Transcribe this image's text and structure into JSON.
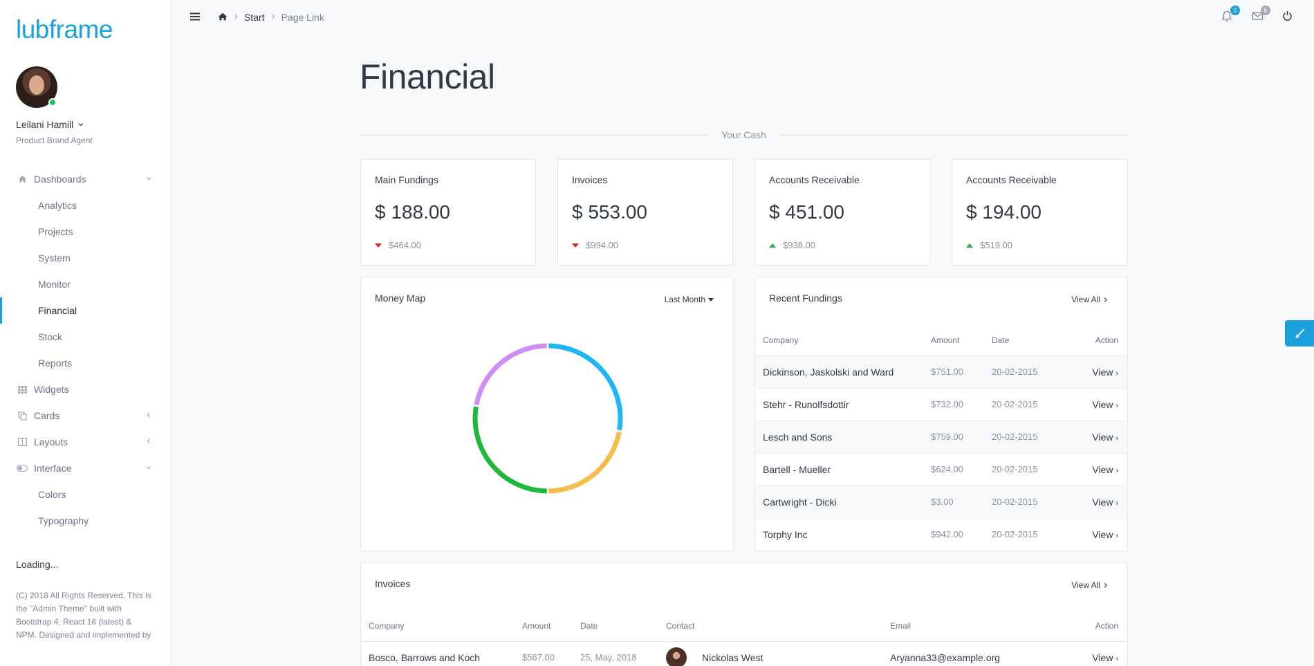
{
  "sidebar": {
    "brand": "lubframe",
    "user_name": "Leilani Hamill",
    "user_role": "Product Brand Agent",
    "menu": [
      {
        "label": "Dashboards",
        "icon": "home-icon"
      },
      {
        "label": "Analytics"
      },
      {
        "label": "Projects"
      },
      {
        "label": "System"
      },
      {
        "label": "Monitor"
      },
      {
        "label": "Financial"
      },
      {
        "label": "Stock"
      },
      {
        "label": "Reports"
      },
      {
        "label": "Widgets",
        "icon": "grid-icon"
      },
      {
        "label": "Cards",
        "icon": "copy-icon"
      },
      {
        "label": "Layouts",
        "icon": "columns-icon"
      },
      {
        "label": "Interface",
        "icon": "toggle-icon"
      },
      {
        "label": "Colors"
      },
      {
        "label": "Typography"
      }
    ],
    "loading": "Loading...",
    "copyright": "(C) 2018 All Rights Reserved. This is the \"Admin Theme\" built with Bootstrap 4, React 16 (latest) & NPM. Designed and implemented by"
  },
  "header": {
    "breadcrumb": [
      "Start",
      "Page Link"
    ],
    "notifications_count": "6",
    "messages_count": "6"
  },
  "page": {
    "title": "Financial",
    "section_label": "Your Cash"
  },
  "stats": [
    {
      "title": "Main Fundings",
      "value": "$ 188.00",
      "sub": "$464.00",
      "trend": "down"
    },
    {
      "title": "Invoices",
      "value": "$ 553.00",
      "sub": "$994.00",
      "trend": "down"
    },
    {
      "title": "Accounts Receivable",
      "value": "$ 451.00",
      "sub": "$938.00",
      "trend": "up"
    },
    {
      "title": "Accounts Receivable",
      "value": "$ 194.00",
      "sub": "$519.00",
      "trend": "up"
    }
  ],
  "money_map": {
    "title": "Money Map",
    "period": "Last Month"
  },
  "chart_data": {
    "type": "pie",
    "title": "",
    "values": [
      25,
      20,
      25,
      20
    ],
    "colors": [
      "#1fb6f5",
      "#f5bd4b",
      "#1db83c",
      "#cf8ef5"
    ]
  },
  "recent": {
    "title": "Recent Fundings",
    "view_all": "View All",
    "headers": [
      "Company",
      "Amount",
      "Date",
      "Action"
    ],
    "rows": [
      {
        "company": "Dickinson, Jaskolski and Ward",
        "amount": "$751.00",
        "date": "20-02-2015",
        "action": "View"
      },
      {
        "company": "Stehr - Runolfsdottir",
        "amount": "$732.00",
        "date": "20-02-2015",
        "action": "View"
      },
      {
        "company": "Lesch and Sons",
        "amount": "$759.00",
        "date": "20-02-2015",
        "action": "View"
      },
      {
        "company": "Bartell - Mueller",
        "amount": "$624.00",
        "date": "20-02-2015",
        "action": "View"
      },
      {
        "company": "Cartwright - Dicki",
        "amount": "$3.00",
        "date": "20-02-2015",
        "action": "View"
      },
      {
        "company": "Torphy Inc",
        "amount": "$942.00",
        "date": "20-02-2015",
        "action": "View"
      }
    ]
  },
  "invoices": {
    "title": "Invoices",
    "view_all": "View All",
    "headers": [
      "Company",
      "Amount",
      "Date",
      "Contact",
      "Email",
      "Action"
    ],
    "rows": [
      {
        "company": "Bosco, Barrows and Koch",
        "amount": "$567.00",
        "date": "25, May, 2018",
        "contact": "Nickolas West",
        "email": "Aryanna33@example.org",
        "action": "View"
      }
    ]
  },
  "colors": {
    "accent": "#1ba0dc"
  }
}
